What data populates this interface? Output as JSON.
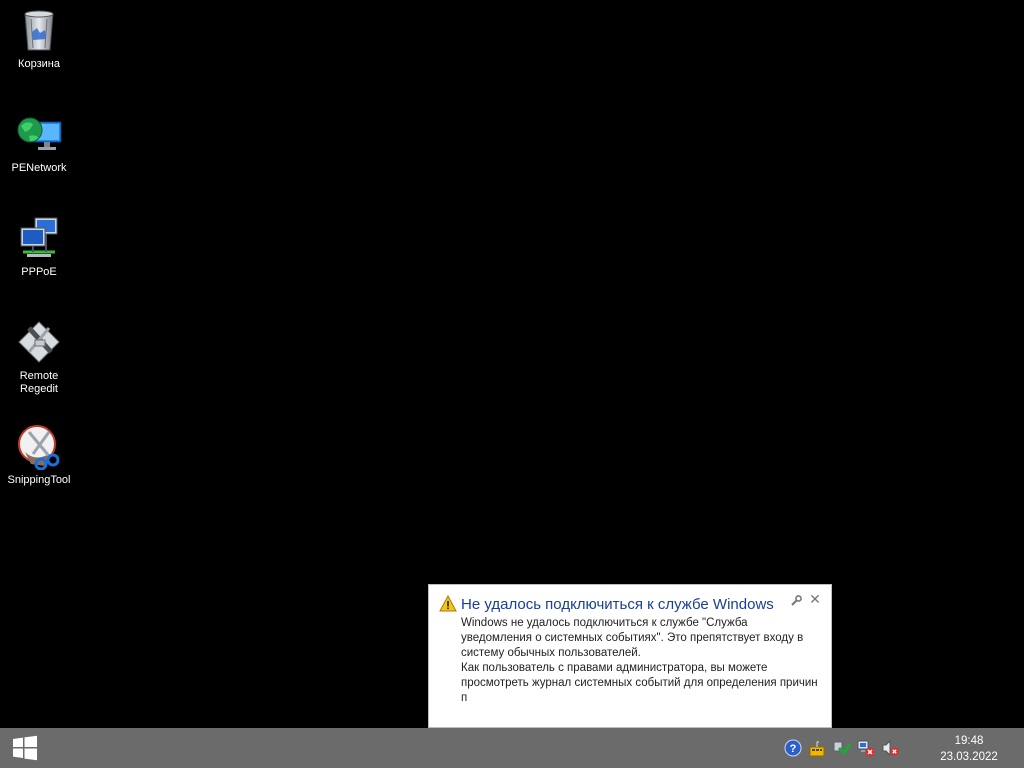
{
  "desktop": {
    "icons": [
      {
        "label": "Корзина",
        "icon": "recycle-bin-icon"
      },
      {
        "label": "PENetwork",
        "icon": "network-globe-icon"
      },
      {
        "label": "PPPoE",
        "icon": "network-computers-icon"
      },
      {
        "label": "Remote Regedit",
        "icon": "remote-regedit-icon"
      },
      {
        "label": "SnippingTool",
        "icon": "scissors-icon"
      }
    ]
  },
  "notification": {
    "title": "Не удалось подключиться к службе Windows",
    "body_line1": "Windows не удалось подключиться к службе \"Служба уведомления о системных событиях\". Это препятствует входу в систему обычных пользователей.",
    "body_line2": "Как пользователь с правами администратора, вы можете просмотреть журнал системных событий для определения причин п",
    "close_symbol": "✕",
    "icon": "warning-icon"
  },
  "taskbar": {
    "start_icon": "windows-logo-icon",
    "tray": [
      {
        "icon": "help-icon"
      },
      {
        "icon": "keyboard-layout-icon"
      },
      {
        "icon": "security-shield-icon"
      },
      {
        "icon": "network-disconnected-icon"
      },
      {
        "icon": "volume-muted-icon"
      }
    ],
    "clock": {
      "time": "19:48",
      "date": "23.03.2022"
    }
  },
  "colors": {
    "desktop_bg": "#000000",
    "taskbar_bg": "#6b6b6b",
    "notification_title": "#1c3f94"
  }
}
